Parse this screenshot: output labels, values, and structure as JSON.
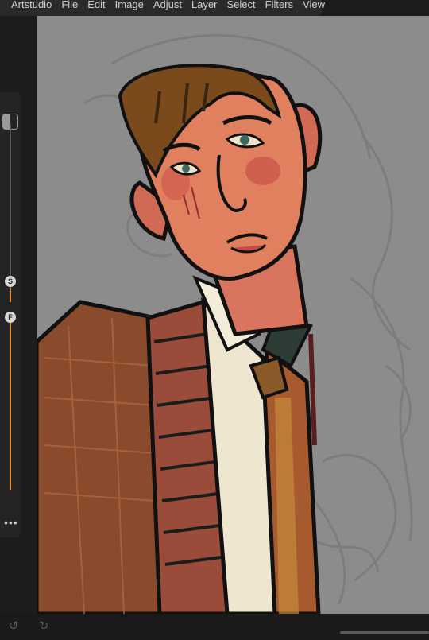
{
  "menu": {
    "app_name": "Artstudio",
    "items": [
      "File",
      "Edit",
      "Image",
      "Adjust",
      "Layer",
      "Select",
      "Filters",
      "View"
    ]
  },
  "side_panel": {
    "size_slider_label": "S",
    "flow_slider_label": "F",
    "more_label": "•••"
  },
  "colors": {
    "accent": "#e48a2e",
    "canvas_bg": "#8c8c8c",
    "ui_bg": "#1c1c1c"
  },
  "icons": {
    "undo": "undo-icon",
    "redo": "redo-icon",
    "layer_toggle": "panel-toggle-icon"
  }
}
